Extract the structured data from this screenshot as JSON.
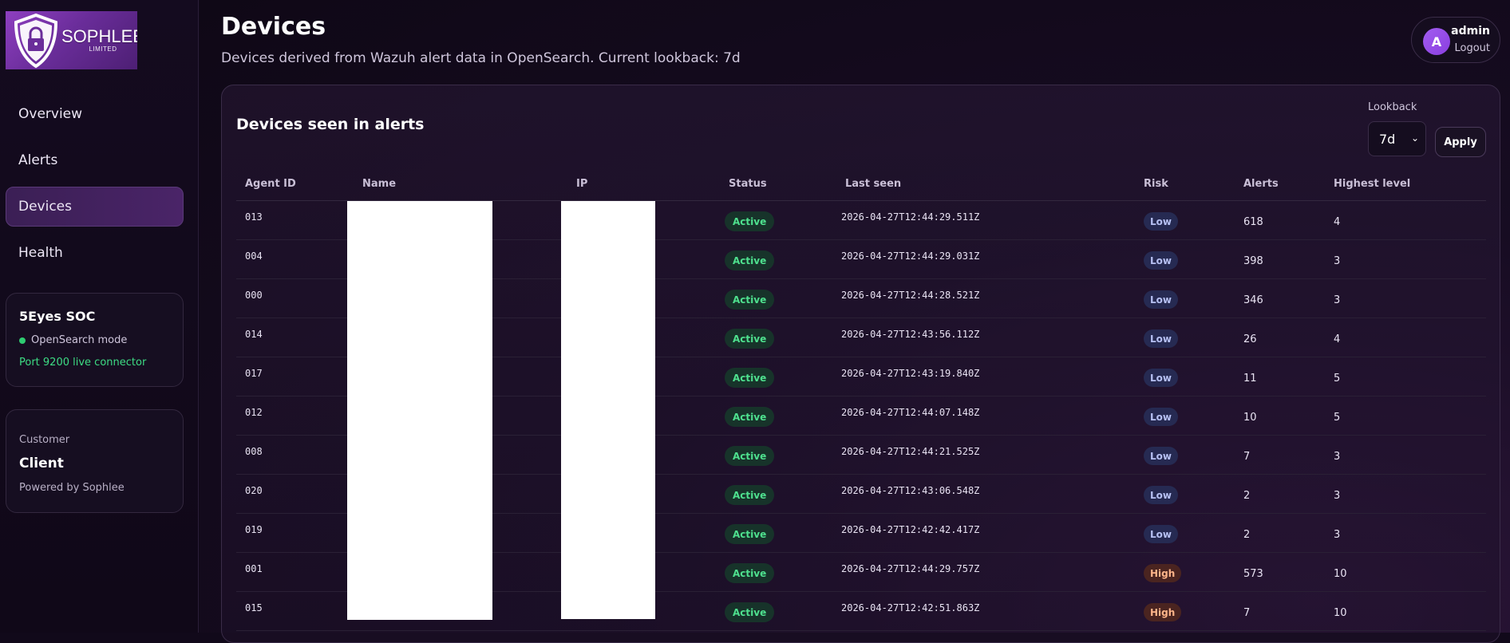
{
  "brand": {
    "name": "SOPHLEE",
    "sub": "LIMITED"
  },
  "sidebar": {
    "items": [
      {
        "label": "Overview",
        "active": false
      },
      {
        "label": "Alerts",
        "active": false
      },
      {
        "label": "Devices",
        "active": true
      },
      {
        "label": "Health",
        "active": false
      }
    ],
    "soc": {
      "title": "5Eyes SOC",
      "mode": "OpenSearch mode",
      "port": "Port 9200 live connector"
    },
    "customer": {
      "label": "Customer",
      "name": "Client",
      "powered": "Powered by Sophlee"
    }
  },
  "header": {
    "title": "Devices",
    "subtitle": "Devices derived from Wazuh alert data in OpenSearch. Current lookback: 7d"
  },
  "user": {
    "initial": "A",
    "name": "admin",
    "logout": "Logout"
  },
  "panel": {
    "title": "Devices seen in alerts",
    "lookback_label": "Lookback",
    "lookback_value": "7d",
    "apply_label": "Apply"
  },
  "table": {
    "columns": [
      "Agent ID",
      "Name",
      "IP",
      "Status",
      "Last seen",
      "Risk",
      "Alerts",
      "Highest level"
    ],
    "rows": [
      {
        "agent_id": "013",
        "status": "Active",
        "last_seen": "2026-04-27T12:44:29.511Z",
        "risk": "Low",
        "alerts": "618",
        "highest_level": "4"
      },
      {
        "agent_id": "004",
        "status": "Active",
        "last_seen": "2026-04-27T12:44:29.031Z",
        "risk": "Low",
        "alerts": "398",
        "highest_level": "3"
      },
      {
        "agent_id": "000",
        "status": "Active",
        "last_seen": "2026-04-27T12:44:28.521Z",
        "risk": "Low",
        "alerts": "346",
        "highest_level": "3"
      },
      {
        "agent_id": "014",
        "status": "Active",
        "last_seen": "2026-04-27T12:43:56.112Z",
        "risk": "Low",
        "alerts": "26",
        "highest_level": "4"
      },
      {
        "agent_id": "017",
        "status": "Active",
        "last_seen": "2026-04-27T12:43:19.840Z",
        "risk": "Low",
        "alerts": "11",
        "highest_level": "5"
      },
      {
        "agent_id": "012",
        "status": "Active",
        "last_seen": "2026-04-27T12:44:07.148Z",
        "risk": "Low",
        "alerts": "10",
        "highest_level": "5"
      },
      {
        "agent_id": "008",
        "status": "Active",
        "last_seen": "2026-04-27T12:44:21.525Z",
        "risk": "Low",
        "alerts": "7",
        "highest_level": "3"
      },
      {
        "agent_id": "020",
        "status": "Active",
        "last_seen": "2026-04-27T12:43:06.548Z",
        "risk": "Low",
        "alerts": "2",
        "highest_level": "3"
      },
      {
        "agent_id": "019",
        "status": "Active",
        "last_seen": "2026-04-27T12:42:42.417Z",
        "risk": "Low",
        "alerts": "2",
        "highest_level": "3"
      },
      {
        "agent_id": "001",
        "status": "Active",
        "last_seen": "2026-04-27T12:44:29.757Z",
        "risk": "High",
        "alerts": "573",
        "highest_level": "10"
      },
      {
        "agent_id": "015",
        "status": "Active",
        "last_seen": "2026-04-27T12:42:51.863Z",
        "risk": "High",
        "alerts": "7",
        "highest_level": "10"
      }
    ]
  },
  "colors": {
    "accent": "#8a3ee0",
    "active_green": "#4ee08e",
    "risk_low": "#b6c0f2",
    "risk_high": "#ffb58a"
  }
}
